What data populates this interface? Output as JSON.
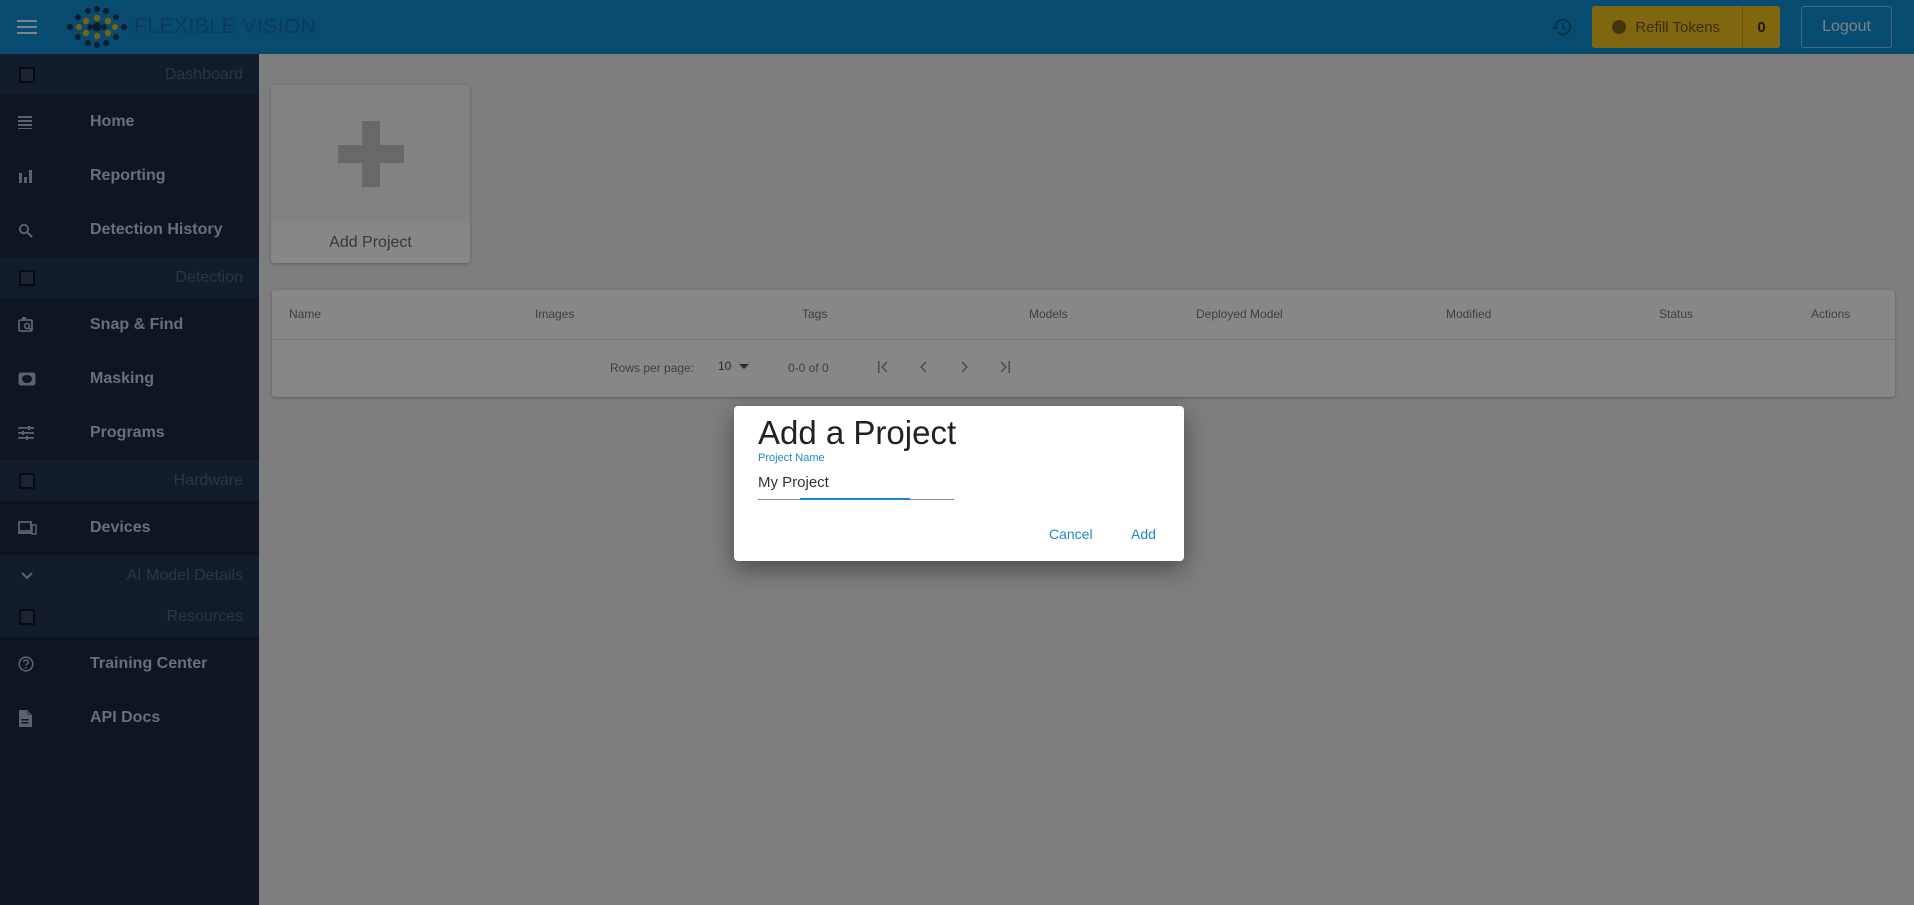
{
  "topbar": {
    "brand_name": "FLEXIBLE VISION",
    "refill_label": "Refill Tokens",
    "token_count": "0",
    "logout_label": "Logout",
    "accent_color": "#0f8fd6",
    "token_color": "#f2c01c"
  },
  "sidebar": {
    "sections": {
      "dashboard": "Dashboard",
      "detection": "Detection",
      "hardware": "Hardware",
      "ai_model_details": "AI Model Details",
      "resources": "Resources"
    },
    "items": {
      "home": "Home",
      "reporting": "Reporting",
      "detection_history": "Detection History",
      "snap_find": "Snap & Find",
      "masking": "Masking",
      "programs": "Programs",
      "devices": "Devices",
      "training_center": "Training Center",
      "api_docs": "API Docs"
    }
  },
  "main": {
    "add_project_label": "Add Project",
    "table": {
      "columns": [
        "Name",
        "Images",
        "Tags",
        "Models",
        "Deployed Model",
        "Modified",
        "Status",
        "Actions"
      ],
      "rows_per_page_label": "Rows per page:",
      "rows_per_page_value": "10",
      "range_text": "0-0 of 0"
    }
  },
  "dialog": {
    "title": "Add a Project",
    "field_label": "Project Name",
    "field_value": "My Project",
    "cancel_label": "Cancel",
    "add_label": "Add"
  }
}
